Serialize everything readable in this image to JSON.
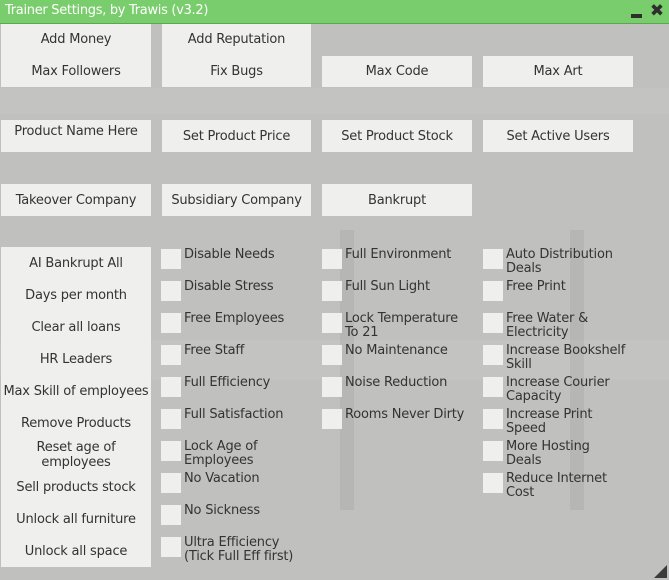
{
  "window": {
    "title": "Trainer Settings, by Trawis (v3.2)",
    "minimize_icon": "minimize-icon",
    "close_icon": "close-icon",
    "resize_icon": "resize-grip-icon",
    "accent_color": "#7acd6c"
  },
  "top_buttons": {
    "add_money": "Add Money",
    "add_reputation": "Add Reputation",
    "max_followers": "Max Followers",
    "fix_bugs": "Fix Bugs",
    "max_code": "Max Code",
    "max_art": "Max Art"
  },
  "product_row": {
    "product_name_placeholder": "Product Name Here",
    "set_product_price": "Set Product Price",
    "set_product_stock": "Set Product Stock",
    "set_active_users": "Set Active Users"
  },
  "company_row": {
    "takeover_company": "Takeover Company",
    "subsidiary_company": "Subsidiary Company",
    "bankrupt": "Bankrupt"
  },
  "left_buttons": [
    {
      "label": "AI Bankrupt All"
    },
    {
      "label": "Days per month"
    },
    {
      "label": "Clear all loans"
    },
    {
      "label": "HR Leaders"
    },
    {
      "label": "Max Skill of employees"
    },
    {
      "label": "Remove Products"
    },
    {
      "label": "Reset age of employees"
    },
    {
      "label": "Sell products stock"
    },
    {
      "label": "Unlock all furniture"
    },
    {
      "label": "Unlock all space"
    }
  ],
  "checkbox_columns": [
    [
      {
        "label": "Disable Needs",
        "checked": false
      },
      {
        "label": "Disable Stress",
        "checked": false
      },
      {
        "label": "Free Employees",
        "checked": false
      },
      {
        "label": "Free Staff",
        "checked": false
      },
      {
        "label": "Full Efficiency",
        "checked": false
      },
      {
        "label": "Full Satisfaction",
        "checked": false
      },
      {
        "label": "Lock Age of Employees",
        "checked": false
      },
      {
        "label": "No Vacation",
        "checked": false
      },
      {
        "label": "No Sickness",
        "checked": false
      },
      {
        "label": "Ultra Efficiency (Tick Full Eff first)",
        "checked": false
      }
    ],
    [
      {
        "label": "Full Environment",
        "checked": false
      },
      {
        "label": "Full Sun Light",
        "checked": false
      },
      {
        "label": "Lock Temperature To 21",
        "checked": false
      },
      {
        "label": "No Maintenance",
        "checked": false
      },
      {
        "label": "Noise Reduction",
        "checked": false
      },
      {
        "label": "Rooms Never Dirty",
        "checked": false
      }
    ],
    [
      {
        "label": "Auto Distribution Deals",
        "checked": false
      },
      {
        "label": "Free Print",
        "checked": false
      },
      {
        "label": "Free Water & Electricity",
        "checked": false
      },
      {
        "label": "Increase Bookshelf Skill",
        "checked": false
      },
      {
        "label": "Increase Courier Capacity",
        "checked": false
      },
      {
        "label": "Increase Print Speed",
        "checked": false
      },
      {
        "label": "More Hosting Deals",
        "checked": false
      },
      {
        "label": "Reduce Internet Cost",
        "checked": false
      }
    ]
  ]
}
